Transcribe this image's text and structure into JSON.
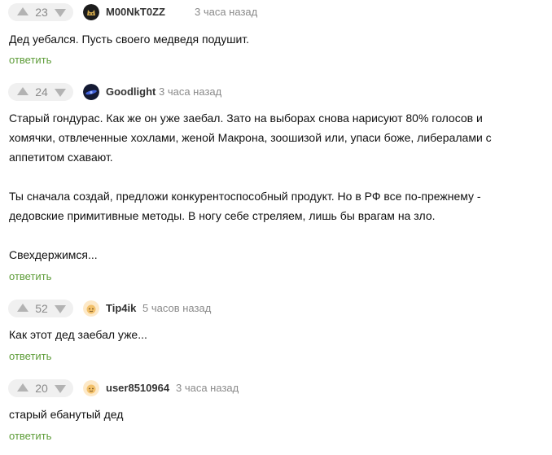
{
  "comments": [
    {
      "votes": "23",
      "avatar_icon": "dark-cat-avatar-icon",
      "username": "M00NkT0ZZ",
      "time": "3 часа назад",
      "body": [
        "Дед уебался. Пусть своего медведя подушит."
      ],
      "reply_label": "ответить"
    },
    {
      "votes": "24",
      "avatar_icon": "dark-space-avatar-icon",
      "username": "Goodlight",
      "time": "3 часа назад",
      "body": [
        "Старый гондурас. Как же он уже заебал. Зато на выборах снова нарисуют 80% голосов и",
        "хомячки, отвлеченные хохлами, женой Макрона, зоошизой или, упаси боже, либералами с",
        "аппетитом схавают.",
        "",
        "Ты сначала создай, предложи конкурентоспособный продукт. Но в РФ все по-прежнему -",
        "дедовские примитивные методы. В ногу себе стреляем, лишь бы врагам на зло.",
        "",
        "Свехдержимся..."
      ],
      "reply_label": "ответить"
    },
    {
      "votes": "52",
      "avatar_icon": "default-pikabu-avatar-icon",
      "username": "Tip4ik",
      "time": "5 часов назад",
      "body": [
        "Как этот дед заебал уже..."
      ],
      "reply_label": "ответить"
    },
    {
      "votes": "20",
      "avatar_icon": "default-pikabu-avatar-icon",
      "username": "user8510964",
      "time": "3 часа назад",
      "body": [
        "старый ебанутый дед"
      ],
      "reply_label": "ответить"
    }
  ],
  "colors": {
    "reply_link": "#5d9c38",
    "vote_pill_bg": "#f0f0f0",
    "vote_arrow": "#b3b3b3",
    "meta_text": "#8a8a8a",
    "username_text": "#333333"
  }
}
